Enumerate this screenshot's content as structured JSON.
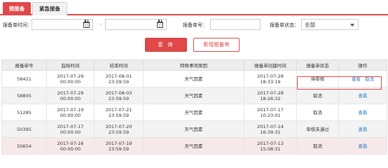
{
  "tabs": [
    {
      "label": "预报备",
      "active": true
    },
    {
      "label": "紧急报备",
      "active": false
    }
  ],
  "filters": {
    "time_label": "报备单时间：",
    "time_start": "",
    "time_separator": "-",
    "time_end": "",
    "number_label": "报备单号：",
    "number_value": "",
    "status_label": "报备单状态：",
    "status_value": "全部"
  },
  "buttons": {
    "query": "查 询",
    "new": "新增报备单"
  },
  "table": {
    "headers": [
      "报备单号",
      "起始时间",
      "结束时间",
      "特殊事项原因",
      "报备单创建时间",
      "报备单状态",
      "操作"
    ],
    "rows": [
      {
        "id": "58421",
        "start_date": "2017-07-29",
        "start_time": "00:00:00",
        "end_date": "2017-08-01",
        "end_time": "23:59:59",
        "reason": "天气因素",
        "created_date": "2017-07-28",
        "created_time": "18:33:19",
        "status": "待审核",
        "actions": [
          "查看",
          "取消"
        ]
      },
      {
        "id": "58805",
        "start_date": "2017-07-29",
        "start_time": "00:00:00",
        "end_date": "2017-08-03",
        "end_time": "23:59:59",
        "reason": "天气因素",
        "created_date": "2017-07-28",
        "created_time": "18:26:32",
        "status": "取消",
        "actions": [
          "查看"
        ]
      },
      {
        "id": "51285",
        "start_date": "2017-07-19",
        "start_time": "00:00:00",
        "end_date": "2017-07-21",
        "end_time": "23:59:59",
        "reason": "天气因素",
        "created_date": "2017-07-17",
        "created_time": "10:23:01",
        "status": "取消",
        "actions": [
          "查看"
        ]
      },
      {
        "id": "50395",
        "start_date": "2017-07-17",
        "start_time": "00:00:00",
        "end_date": "2017-07-20",
        "end_time": "23:59:59",
        "reason": "天气因素",
        "created_date": "2017-07-14",
        "created_time": "16:39:31",
        "status": "审核未通过",
        "actions": [
          "查看"
        ]
      },
      {
        "id": "50654",
        "start_date": "2017-07-16",
        "start_time": "00:00:00",
        "end_date": "2017-07-19",
        "end_time": "23:59:59",
        "reason": "天气因素",
        "created_date": "2017-07-13",
        "created_time": "15:08:31",
        "status": "取消",
        "actions": [
          "查看"
        ]
      }
    ]
  },
  "colors": {
    "accent": "#e0484a",
    "link": "#2b79c2"
  }
}
